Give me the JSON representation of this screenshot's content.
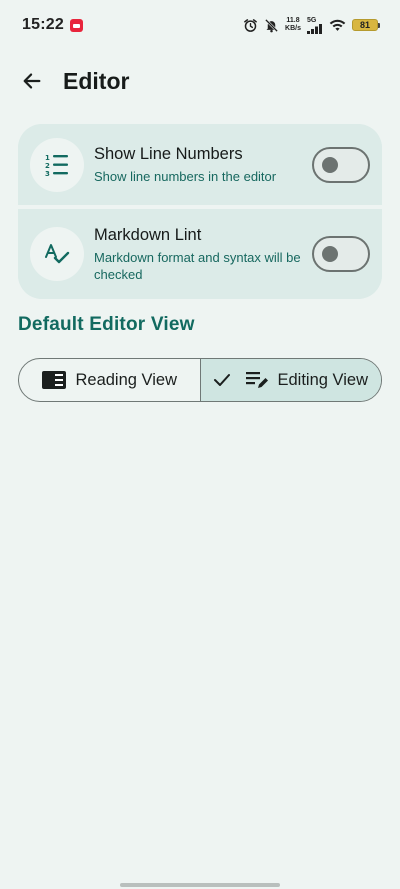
{
  "status_bar": {
    "time": "15:22",
    "net_speed_value": "11.8",
    "net_speed_unit": "KB/s",
    "network_type": "5G",
    "battery_level": "81",
    "battery_color": "#d8b640"
  },
  "app_bar": {
    "title": "Editor",
    "back_icon": "arrow-left-icon"
  },
  "settings": [
    {
      "icon": "line-numbers-icon",
      "title": "Show Line Numbers",
      "subtitle": "Show line numbers in the editor",
      "enabled": false
    },
    {
      "icon": "spellcheck-icon",
      "title": "Markdown Lint",
      "subtitle": "Markdown format and syntax will be checked",
      "enabled": false
    }
  ],
  "default_view": {
    "section_title": "Default Editor View",
    "options": [
      {
        "label": "Reading View",
        "icon": "book-open-icon",
        "selected": false
      },
      {
        "label": "Editing View",
        "icon": "edit-note-icon",
        "selected": true
      }
    ]
  },
  "colors": {
    "background": "#eef4f2",
    "card": "#dcebe8",
    "accent": "#126a60",
    "selected_segment": "#cfe5e1"
  }
}
